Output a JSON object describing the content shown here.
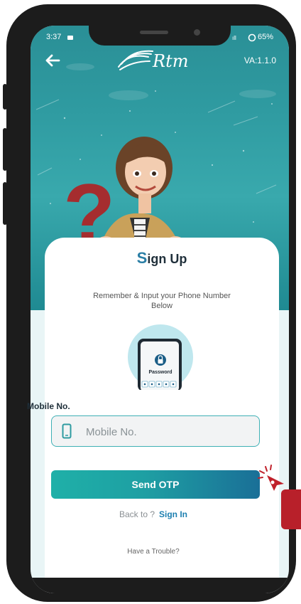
{
  "status": {
    "time": "3:37",
    "battery": "65%"
  },
  "header": {
    "logo_text": "Rtm",
    "version": "VA:1.1.0"
  },
  "card": {
    "title_first": "S",
    "title_rest": "ign Up",
    "subtitle": "Remember & Input your Phone Number Below",
    "illustration_text": "Password"
  },
  "form": {
    "mobile_label": "Mobile No.",
    "mobile_placeholder": "Mobile No.",
    "send_button": "Send OTP",
    "back_prompt": "Back to ?",
    "sign_in_link": "Sign In",
    "trouble_link": "Have a Trouble?"
  },
  "colors": {
    "teal": "#2f9ba1",
    "accent": "#1c7fb0",
    "button_start": "#1fb0a8",
    "button_end": "#1a6f97",
    "question_mark": "#a52d2f"
  },
  "icons": [
    "back-arrow-icon",
    "signal-icon",
    "battery-icon",
    "mobile-phone-icon",
    "password-phone-icon",
    "tap-cursor-icon"
  ]
}
